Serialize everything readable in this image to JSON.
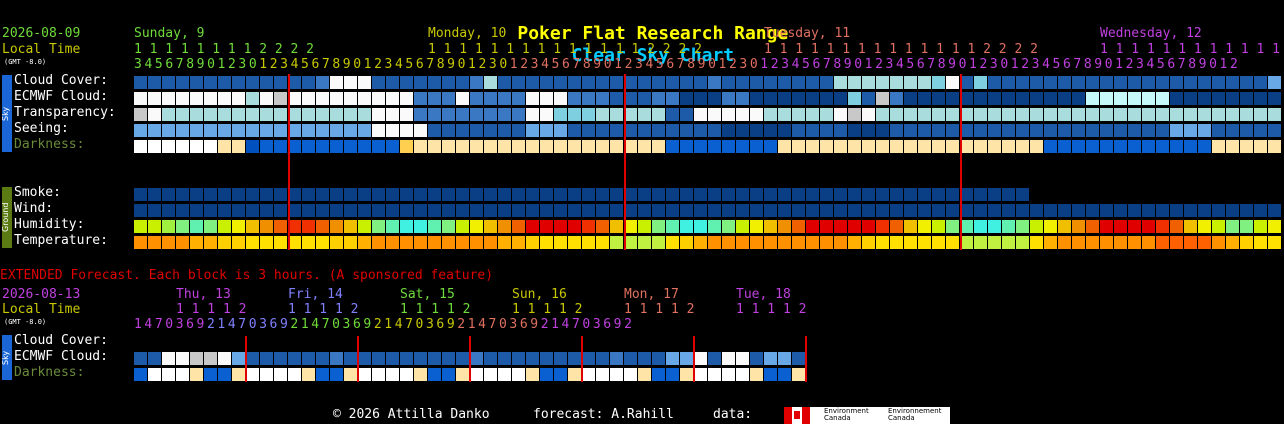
{
  "title": {
    "site": "Poker Flat Research Range",
    "chart": "Clear Sky Chart"
  },
  "colors": {
    "yellow": "#ffff00",
    "cyan": "#00ccff",
    "green": "#6fdc3a",
    "olive": "#c8c800",
    "purple": "#c040e0",
    "red": "#e00000",
    "white": "#ffffff",
    "dim_green": "#6a8a3a"
  },
  "main": {
    "date": "2026-08-09",
    "local_time": "Local Time",
    "gmt": "(GMT -8.0)",
    "days": [
      {
        "label": "Sunday, 9",
        "color": "#6fdc3a"
      },
      {
        "label": "Monday, 10",
        "color": "#c8c800"
      },
      {
        "label": "Tuesday, 11",
        "color": "#e07060"
      },
      {
        "label": "Wednesday, 12",
        "color": "#c040e0"
      }
    ],
    "hours_tens": [
      "1 1 1 1 1 1 1 1 2 2 2 2",
      "1 1 1 1 1 1 1 1 1 1 1 1 1 1 2 2 2 2",
      "1 1 1 1 1 1 1 1 1 1 1 1 1 1 2 2 2 2",
      "1 1 1 1 1 1 1 1 1 1 1 1 2 2 2"
    ],
    "hours_ones": "3456789012301234567890123456789012301234567890123456789012301234567890123456789012301234567890123456789012",
    "sky_tab": "Sky",
    "ground_tab": "Ground",
    "rows": {
      "cloud": "Cloud Cover:",
      "ecmwf": "ECMWF Cloud:",
      "transparency": "Transparency:",
      "seeing": "Seeing:",
      "darkness": "Darkness:",
      "smoke": "Smoke:",
      "wind": "Wind:",
      "humidity": "Humidity:",
      "temperature": "Temperature:"
    }
  },
  "extended": {
    "note": "EXTENDED Forecast. Each block is 3 hours. (A sponsored feature)",
    "date": "2026-08-13",
    "local_time": "Local Time",
    "gmt": "(GMT -8.0)",
    "days": [
      {
        "label": "Thu, 13",
        "color": "#c040e0"
      },
      {
        "label": "Fri, 14",
        "color": "#8080ff"
      },
      {
        "label": "Sat, 15",
        "color": "#6fdc3a"
      },
      {
        "label": "Sun, 16",
        "color": "#c8c800"
      },
      {
        "label": "Mon, 17",
        "color": "#e07060"
      },
      {
        "label": "Tue, 18",
        "color": "#c040e0"
      }
    ],
    "tens": [
      "1 1 1 1 2",
      "1 1 1 1 2",
      "1 1 1 1 2",
      "1 1 1 1 2",
      "1 1 1 1 2",
      "1 1 1 1 2"
    ],
    "ones": [
      "1470369",
      "21470369",
      "21470369",
      "21470369",
      "21470369",
      "214703692"
    ],
    "sky_tab": "Sky",
    "rows": {
      "cloud": "Cloud Cover:",
      "ecmwf": "ECMWF Cloud:",
      "darkness": "Darkness:"
    }
  },
  "footer": {
    "copyright": "© 2026 Attilla Danko",
    "forecast": "forecast: A.Rahill",
    "data": "data:",
    "env_en": "Environment Canada",
    "env_fr": "Environnement Canada"
  }
}
